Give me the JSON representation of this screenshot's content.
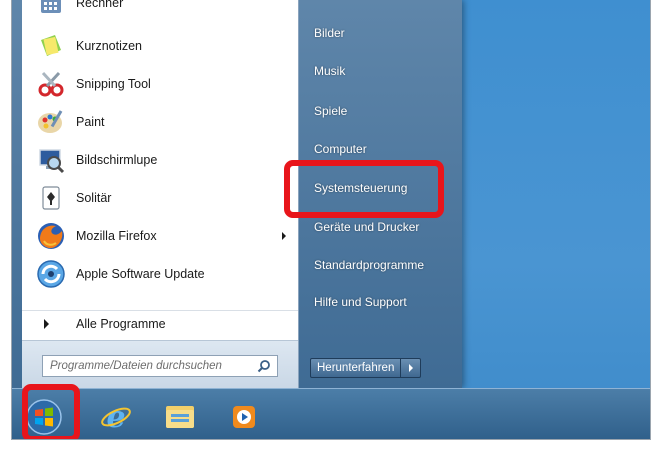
{
  "programs": [
    {
      "label": "Rechner",
      "icon": "calculator-icon"
    },
    {
      "label": "Kurznotizen",
      "icon": "sticky-notes-icon"
    },
    {
      "label": "Snipping Tool",
      "icon": "scissors-icon"
    },
    {
      "label": "Paint",
      "icon": "paint-palette-icon"
    },
    {
      "label": "Bildschirmlupe",
      "icon": "magnifier-icon"
    },
    {
      "label": "Solitär",
      "icon": "cards-icon"
    },
    {
      "label": "Mozilla Firefox",
      "icon": "firefox-icon"
    },
    {
      "label": "Apple Software Update",
      "icon": "apple-update-icon"
    }
  ],
  "all_programs": "Alle Programme",
  "search": {
    "placeholder": "Programme/Dateien durchsuchen"
  },
  "right_items": [
    "Bilder",
    "Musik",
    "Spiele",
    "Computer",
    "Systemsteuerung",
    "Geräte und Drucker",
    "Standardprogramme",
    "Hilfe und Support"
  ],
  "shutdown_label": "Herunterfahren",
  "colors": {
    "highlight": "#e8151b",
    "taskbar": "#2f5f8a",
    "desktop": "#4a95d2"
  }
}
